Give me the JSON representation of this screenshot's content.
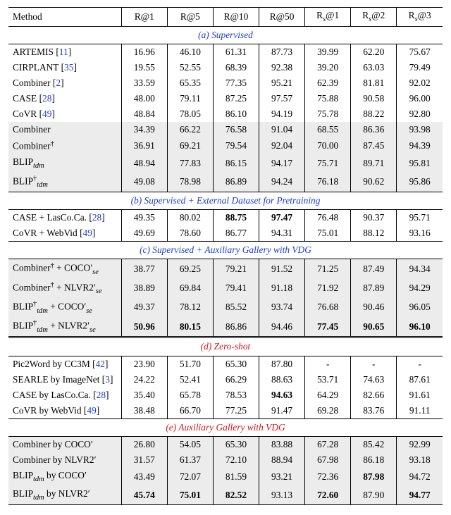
{
  "chart_data": {
    "type": "table",
    "title": null,
    "columns": [
      "Method",
      "R@1",
      "R@5",
      "R@10",
      "R@50",
      "R_s@1",
      "R_s@2",
      "R_s@3"
    ],
    "sections": [
      {
        "label": "(a) Supervised",
        "rows": [
          [
            "ARTEMIS [11]",
            [
              16.96,
              46.1,
              61.31,
              87.73,
              39.99,
              62.2,
              75.67
            ]
          ],
          [
            "CIRPLANT [35]",
            [
              19.55,
              52.55,
              68.39,
              92.38,
              39.2,
              63.03,
              79.49
            ]
          ],
          [
            "Combiner [2]",
            [
              33.59,
              65.35,
              77.35,
              95.21,
              62.39,
              81.81,
              92.02
            ]
          ],
          [
            "CASE [28]",
            [
              48.0,
              79.11,
              87.25,
              97.57,
              75.88,
              90.58,
              96.0
            ]
          ],
          [
            "CoVR [49]",
            [
              48.84,
              78.05,
              86.1,
              94.19,
              75.78,
              88.22,
              92.8
            ]
          ],
          [
            "Combiner",
            [
              34.39,
              66.22,
              76.58,
              91.04,
              68.55,
              86.36,
              93.98
            ]
          ],
          [
            "Combiner†",
            [
              36.91,
              69.21,
              79.54,
              92.04,
              70.0,
              87.45,
              94.39
            ]
          ],
          [
            "BLIP_tdm",
            [
              48.94,
              77.83,
              86.15,
              94.17,
              75.71,
              89.71,
              95.81
            ]
          ],
          [
            "BLIP†_tdm",
            [
              49.08,
              78.98,
              86.89,
              94.24,
              76.18,
              90.62,
              95.86
            ]
          ]
        ],
        "highlight_from": 5
      },
      {
        "label": "(b) Supervised + External Dataset for Pretraining",
        "rows": [
          [
            "CASE + LasCo.Ca. [28]",
            [
              49.35,
              80.02,
              "88.75*",
              "97.47*",
              76.48,
              90.37,
              95.71
            ]
          ],
          [
            "CoVR + WebVid [49]",
            [
              49.69,
              78.6,
              86.77,
              94.31,
              75.01,
              88.12,
              93.16
            ]
          ]
        ]
      },
      {
        "label": "(c) Supervised + Auxiliary Gallery with VDG",
        "rows": [
          [
            "Combiner† + COCO'_se",
            [
              38.77,
              69.25,
              79.21,
              91.52,
              71.25,
              87.49,
              94.34
            ]
          ],
          [
            "Combiner† + NLVR2'_se",
            [
              38.89,
              69.84,
              79.41,
              91.18,
              71.92,
              87.89,
              94.29
            ]
          ],
          [
            "BLIP†_tdm + COCO'_se",
            [
              49.37,
              78.12,
              85.52,
              93.74,
              76.68,
              90.46,
              96.05
            ]
          ],
          [
            "BLIP†_tdm + NLVR2'_se",
            [
              "50.96*",
              "80.15*",
              86.86,
              94.46,
              "77.45*",
              "90.65*",
              "96.10*"
            ]
          ]
        ],
        "highlight_from": 0
      },
      {
        "label": "(d) Zero-shot",
        "color": "red",
        "rows": [
          [
            "Pic2Word by CC3M [42]",
            [
              23.9,
              51.7,
              65.3,
              87.8,
              "-",
              "-",
              "-"
            ]
          ],
          [
            "SEARLE by ImageNet [3]",
            [
              24.22,
              52.41,
              66.29,
              88.63,
              53.71,
              74.63,
              87.61
            ]
          ],
          [
            "CASE by LasCo.Ca. [28]",
            [
              35.4,
              65.78,
              78.53,
              "94.63*",
              64.29,
              82.66,
              91.61
            ]
          ],
          [
            "CoVR by WebVid [49]",
            [
              38.48,
              66.7,
              77.25,
              91.47,
              69.28,
              83.76,
              91.11
            ]
          ]
        ]
      },
      {
        "label": "(e) Auxiliary Gallery with VDG",
        "color": "red",
        "rows": [
          [
            "Combiner by COCO'",
            [
              26.8,
              54.05,
              65.3,
              83.88,
              67.28,
              85.42,
              92.99
            ]
          ],
          [
            "Combiner by NLVR2'",
            [
              31.57,
              61.37,
              72.1,
              88.94,
              67.98,
              86.18,
              93.18
            ]
          ],
          [
            "BLIP_tdm by COCO'",
            [
              43.49,
              72.07,
              81.59,
              93.21,
              72.36,
              "87.98*",
              94.72
            ]
          ],
          [
            "BLIP_tdm by NLVR2'",
            [
              "45.74*",
              "75.01*",
              "82.52*",
              93.13,
              "72.60*",
              87.9,
              "94.77*"
            ]
          ]
        ],
        "highlight_from": 0
      }
    ]
  }
}
